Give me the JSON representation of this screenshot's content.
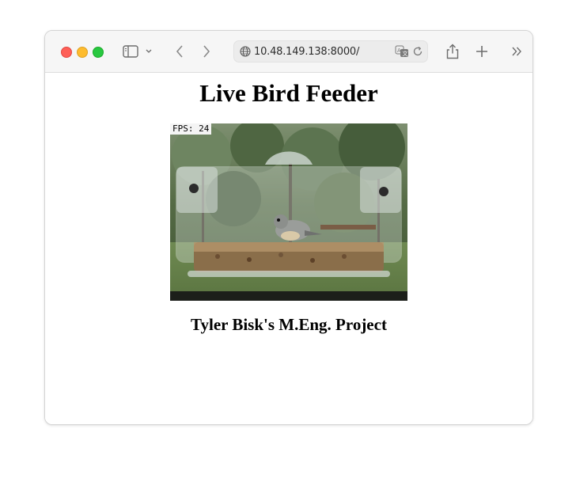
{
  "browser": {
    "address_url": "10.48.149.138:8000/"
  },
  "page": {
    "heading": "Live Bird Feeder",
    "video_overlay": "FPS: 24",
    "subheading": "Tyler Bisk's M.Eng. Project"
  },
  "icons": [
    "sidebar-icon",
    "chevron-down-icon",
    "back-icon",
    "forward-icon",
    "globe-icon",
    "translate-icon",
    "reload-icon",
    "share-icon",
    "new-tab-icon",
    "more-icon"
  ],
  "colors": {
    "close": "#fe5f57",
    "minimize": "#febc2e",
    "zoom": "#28c840"
  }
}
